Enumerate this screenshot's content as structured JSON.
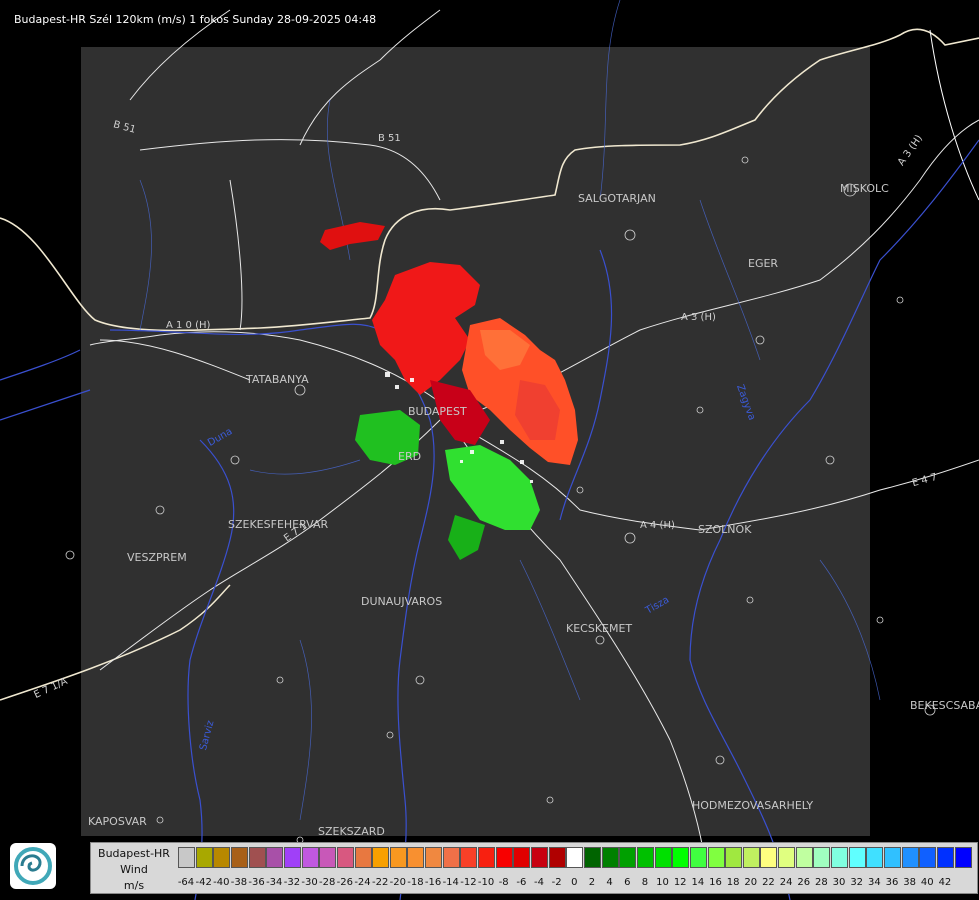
{
  "title": "Budapest-HR Szél 120km (m/s) 1 fokos Sunday 28-09-2025 04:48",
  "cities": [
    {
      "name": "SALGOTARJAN"
    },
    {
      "name": "EGER"
    },
    {
      "name": "MISKOLC"
    },
    {
      "name": "TATABANYA"
    },
    {
      "name": "BUDAPEST"
    },
    {
      "name": "ERD"
    },
    {
      "name": "SZEKESFEHERVAR"
    },
    {
      "name": "VESZPREM"
    },
    {
      "name": "DUNAUJVAROS"
    },
    {
      "name": "KECSKEMET"
    },
    {
      "name": "SZOLNOK"
    },
    {
      "name": "BEKESCSABA"
    },
    {
      "name": "HODMEZOVASARHELY"
    },
    {
      "name": "KAPOSVAR"
    },
    {
      "name": "SZEKSZARD"
    }
  ],
  "roads": [
    {
      "name": "B 51"
    },
    {
      "name": "B 51"
    },
    {
      "name": "A 1 0 (H)"
    },
    {
      "name": "A 3 (H)"
    },
    {
      "name": "A 3 (H)"
    },
    {
      "name": "E 4 7"
    },
    {
      "name": "A 4 (H)"
    },
    {
      "name": "E 7 1"
    },
    {
      "name": "E 7 1/A"
    }
  ],
  "rivers": [
    {
      "name": "Duna"
    },
    {
      "name": "Zagyva"
    },
    {
      "name": "Tisza"
    },
    {
      "name": "Sarviz"
    }
  ],
  "legend": {
    "name": "Budapest-HR",
    "quantity": "Wind",
    "unit": "m/s",
    "colors": [
      "#c8c8c8",
      "#a8a800",
      "#b88800",
      "#a86018",
      "#a05050",
      "#a850a8",
      "#a040f8",
      "#c058e0",
      "#c858b8",
      "#d85880",
      "#e87840",
      "#f8a000",
      "#f89820",
      "#f89030",
      "#f08840",
      "#f07048",
      "#f84028",
      "#f82010",
      "#f80000",
      "#e00000",
      "#c80010",
      "#b00000",
      "#ffffff",
      "#006400",
      "#008000",
      "#00a000",
      "#00c000",
      "#00e000",
      "#00ff00",
      "#40ff40",
      "#80ff40",
      "#a0e840",
      "#c0f060",
      "#ffff80",
      "#e0ff80",
      "#c0ffa0",
      "#a0ffc0",
      "#80ffe0",
      "#60ffff",
      "#40e0ff",
      "#30c0ff",
      "#2090ff",
      "#1060ff",
      "#0030ff",
      "#0000ff"
    ],
    "ticks": [
      "-64",
      "-42",
      "-40",
      "-38",
      "-36",
      "-34",
      "-32",
      "-30",
      "-28",
      "-26",
      "-24",
      "-22",
      "-20",
      "-18",
      "-16",
      "-14",
      "-12",
      "-10",
      "-8",
      "-6",
      "-4",
      "-2",
      "0",
      "2",
      "4",
      "6",
      "8",
      "10",
      "12",
      "14",
      "16",
      "18",
      "20",
      "22",
      "24",
      "26",
      "28",
      "30",
      "32",
      "34",
      "36",
      "38",
      "40",
      "42"
    ]
  }
}
